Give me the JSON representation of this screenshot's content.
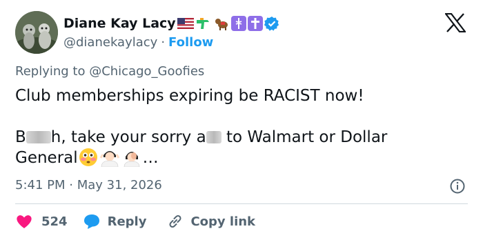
{
  "author": {
    "display_name": "Diane Kay Lacy",
    "handle": "@dianekaylacy",
    "separator": "·",
    "follow_label": "Follow",
    "name_emojis": [
      "us-flag-emoji",
      "water-pistol-emoji",
      "service-dog-emoji",
      "medical-symbol-emoji",
      "latin-cross-emoji",
      "verified-badge-icon"
    ]
  },
  "reply": {
    "prefix": "Replying to ",
    "mention": "@Chicago_Goofies"
  },
  "tweet": {
    "line1": "Club memberships expiring be RACIST now!",
    "line2_a": "B",
    "line2_b": "h, take your sorry a",
    "line2_c": " to Walmart or Dollar",
    "line3_a": "General",
    "line3_ellipsis": "…"
  },
  "meta": {
    "time": "5:41 PM",
    "separator": "·",
    "date": "May 31, 2026"
  },
  "actions": {
    "like_count": "524",
    "reply_label": "Reply",
    "copy_label": "Copy link"
  },
  "colors": {
    "accent": "#1d9bf0",
    "like": "#f91880",
    "text": "#0f1419",
    "muted": "#536471",
    "divider": "#cfd9de"
  }
}
